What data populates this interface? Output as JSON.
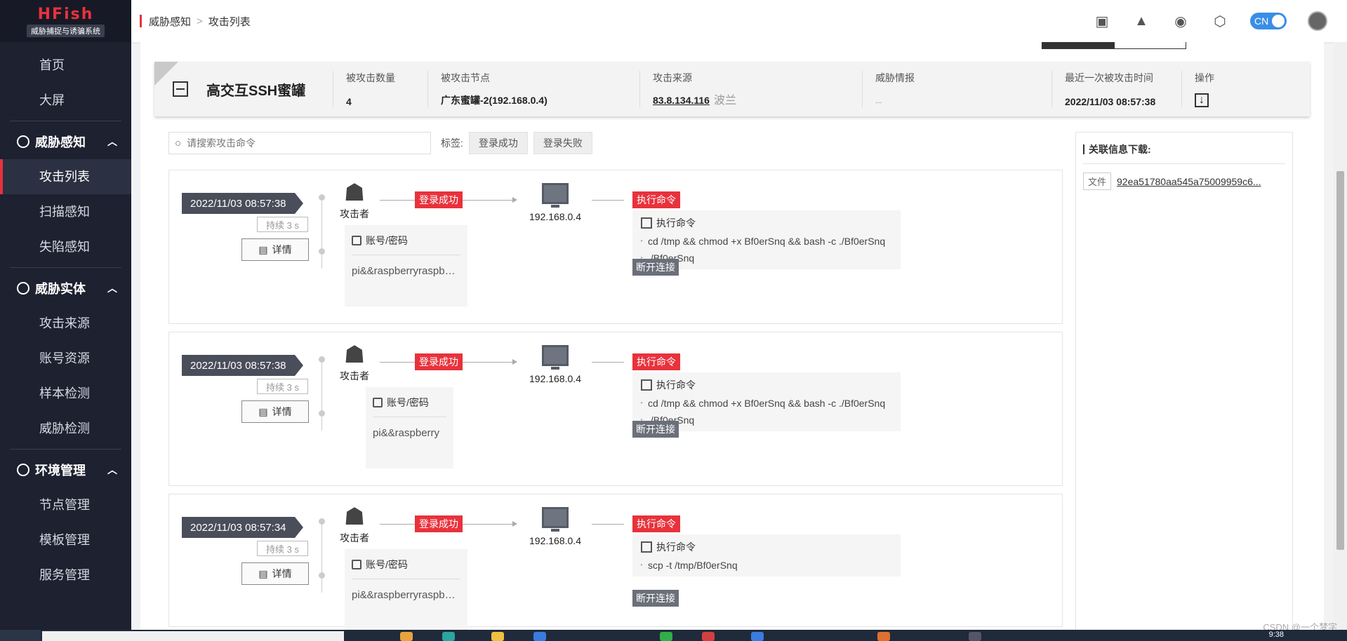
{
  "app": {
    "brand": "HFish",
    "subtitle": "威胁捕捉与诱骗系统"
  },
  "sidebar": {
    "top_items": [
      {
        "label": "首页"
      },
      {
        "label": "大屏"
      }
    ],
    "groups": [
      {
        "label": "威胁感知",
        "items": [
          {
            "label": "攻击列表",
            "active": true
          },
          {
            "label": "扫描感知"
          },
          {
            "label": "失陷感知"
          }
        ]
      },
      {
        "label": "威胁实体",
        "items": [
          {
            "label": "攻击来源"
          },
          {
            "label": "账号资源"
          },
          {
            "label": "样本检测"
          },
          {
            "label": "威胁检测"
          }
        ]
      },
      {
        "label": "环境管理",
        "items": [
          {
            "label": "节点管理"
          },
          {
            "label": "模板管理"
          },
          {
            "label": "服务管理"
          }
        ]
      }
    ]
  },
  "header": {
    "breadcrumb": [
      "威胁感知",
      "攻击列表"
    ],
    "lang_toggle": "CN",
    "icons": [
      "notebook-icon",
      "rocket-icon",
      "wechat-icon",
      "hexagon-icon"
    ]
  },
  "summary": {
    "title": "高交互SSH蜜罐",
    "columns": [
      {
        "label": "被攻击数量",
        "value": "4"
      },
      {
        "label": "被攻击节点",
        "value": "广东蜜罐-2(192.168.0.4)"
      },
      {
        "label": "攻击来源",
        "value": "83.8.134.116",
        "extra": "波兰"
      },
      {
        "label": "威胁情报",
        "value": "--"
      },
      {
        "label": "最近一次被攻击时间",
        "value": "2022/11/03 08:57:38"
      },
      {
        "label": "操作"
      }
    ]
  },
  "filter": {
    "search_placeholder": "请搜索攻击命令",
    "tag_label": "标签:",
    "tags": [
      "登录成功",
      "登录失败"
    ]
  },
  "records": [
    {
      "time": "2022/11/03 08:57:38",
      "duration": "持续 3 s",
      "detail": "详情",
      "attacker": "攻击者",
      "login_badge": "登录成功",
      "node_ip": "192.168.0.4",
      "cmd_badge": "执行命令",
      "cred_title": "账号/密码",
      "cred_value": "pi&&raspberryraspberry",
      "cmd_title": "执行命令",
      "commands": [
        "cd /tmp && chmod +x Bf0erSnq && bash -c ./Bf0erSnq",
        "./Bf0erSnq"
      ],
      "disconnect": "断开连接"
    },
    {
      "time": "2022/11/03 08:57:38",
      "duration": "持续 3 s",
      "detail": "详情",
      "attacker": "攻击者",
      "login_badge": "登录成功",
      "node_ip": "192.168.0.4",
      "cmd_badge": "执行命令",
      "cred_title": "账号/密码",
      "cred_value": "pi&&raspberry",
      "cmd_title": "执行命令",
      "commands": [
        "cd /tmp && chmod +x Bf0erSnq && bash -c ./Bf0erSnq",
        "./Bf0erSnq"
      ],
      "disconnect": "断开连接"
    },
    {
      "time": "2022/11/03 08:57:34",
      "duration": "持续 3 s",
      "detail": "详情",
      "attacker": "攻击者",
      "login_badge": "登录成功",
      "node_ip": "192.168.0.4",
      "cmd_badge": "执行命令",
      "cred_title": "账号/密码",
      "cred_value": "pi&&raspberryraspberry",
      "cmd_title": "执行命令",
      "commands": [
        "scp -t /tmp/Bf0erSnq"
      ],
      "disconnect": "断开连接"
    }
  ],
  "related": {
    "title": "关联信息下载:",
    "file_tag": "文件",
    "file_link": "92ea51780aa545a75009959c6..."
  },
  "taskbar": {
    "clock": "9:38"
  },
  "watermark": "CSDN @一个梦字"
}
